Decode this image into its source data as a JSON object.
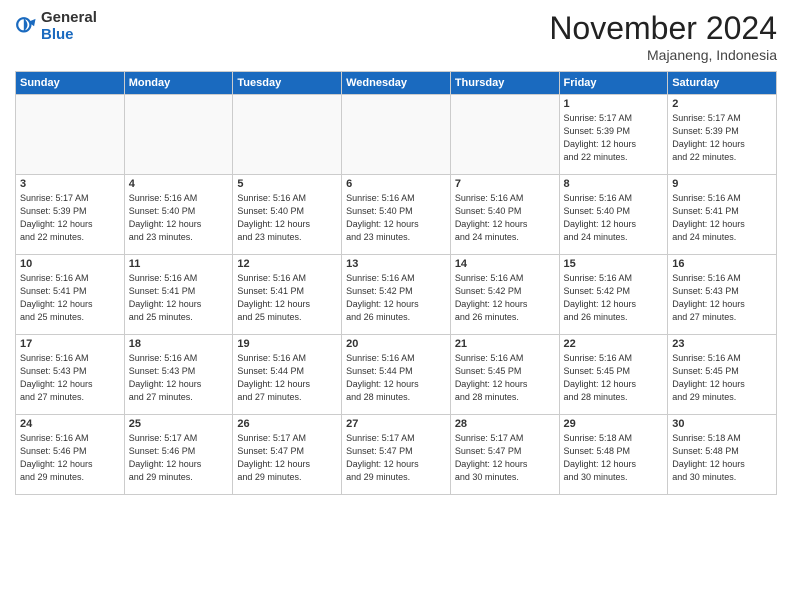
{
  "logo": {
    "general": "General",
    "blue": "Blue"
  },
  "header": {
    "month": "November 2024",
    "location": "Majaneng, Indonesia"
  },
  "weekdays": [
    "Sunday",
    "Monday",
    "Tuesday",
    "Wednesday",
    "Thursday",
    "Friday",
    "Saturday"
  ],
  "weeks": [
    [
      {
        "day": "",
        "info": ""
      },
      {
        "day": "",
        "info": ""
      },
      {
        "day": "",
        "info": ""
      },
      {
        "day": "",
        "info": ""
      },
      {
        "day": "",
        "info": ""
      },
      {
        "day": "1",
        "info": "Sunrise: 5:17 AM\nSunset: 5:39 PM\nDaylight: 12 hours\nand 22 minutes."
      },
      {
        "day": "2",
        "info": "Sunrise: 5:17 AM\nSunset: 5:39 PM\nDaylight: 12 hours\nand 22 minutes."
      }
    ],
    [
      {
        "day": "3",
        "info": "Sunrise: 5:17 AM\nSunset: 5:39 PM\nDaylight: 12 hours\nand 22 minutes."
      },
      {
        "day": "4",
        "info": "Sunrise: 5:16 AM\nSunset: 5:40 PM\nDaylight: 12 hours\nand 23 minutes."
      },
      {
        "day": "5",
        "info": "Sunrise: 5:16 AM\nSunset: 5:40 PM\nDaylight: 12 hours\nand 23 minutes."
      },
      {
        "day": "6",
        "info": "Sunrise: 5:16 AM\nSunset: 5:40 PM\nDaylight: 12 hours\nand 23 minutes."
      },
      {
        "day": "7",
        "info": "Sunrise: 5:16 AM\nSunset: 5:40 PM\nDaylight: 12 hours\nand 24 minutes."
      },
      {
        "day": "8",
        "info": "Sunrise: 5:16 AM\nSunset: 5:40 PM\nDaylight: 12 hours\nand 24 minutes."
      },
      {
        "day": "9",
        "info": "Sunrise: 5:16 AM\nSunset: 5:41 PM\nDaylight: 12 hours\nand 24 minutes."
      }
    ],
    [
      {
        "day": "10",
        "info": "Sunrise: 5:16 AM\nSunset: 5:41 PM\nDaylight: 12 hours\nand 25 minutes."
      },
      {
        "day": "11",
        "info": "Sunrise: 5:16 AM\nSunset: 5:41 PM\nDaylight: 12 hours\nand 25 minutes."
      },
      {
        "day": "12",
        "info": "Sunrise: 5:16 AM\nSunset: 5:41 PM\nDaylight: 12 hours\nand 25 minutes."
      },
      {
        "day": "13",
        "info": "Sunrise: 5:16 AM\nSunset: 5:42 PM\nDaylight: 12 hours\nand 26 minutes."
      },
      {
        "day": "14",
        "info": "Sunrise: 5:16 AM\nSunset: 5:42 PM\nDaylight: 12 hours\nand 26 minutes."
      },
      {
        "day": "15",
        "info": "Sunrise: 5:16 AM\nSunset: 5:42 PM\nDaylight: 12 hours\nand 26 minutes."
      },
      {
        "day": "16",
        "info": "Sunrise: 5:16 AM\nSunset: 5:43 PM\nDaylight: 12 hours\nand 27 minutes."
      }
    ],
    [
      {
        "day": "17",
        "info": "Sunrise: 5:16 AM\nSunset: 5:43 PM\nDaylight: 12 hours\nand 27 minutes."
      },
      {
        "day": "18",
        "info": "Sunrise: 5:16 AM\nSunset: 5:43 PM\nDaylight: 12 hours\nand 27 minutes."
      },
      {
        "day": "19",
        "info": "Sunrise: 5:16 AM\nSunset: 5:44 PM\nDaylight: 12 hours\nand 27 minutes."
      },
      {
        "day": "20",
        "info": "Sunrise: 5:16 AM\nSunset: 5:44 PM\nDaylight: 12 hours\nand 28 minutes."
      },
      {
        "day": "21",
        "info": "Sunrise: 5:16 AM\nSunset: 5:45 PM\nDaylight: 12 hours\nand 28 minutes."
      },
      {
        "day": "22",
        "info": "Sunrise: 5:16 AM\nSunset: 5:45 PM\nDaylight: 12 hours\nand 28 minutes."
      },
      {
        "day": "23",
        "info": "Sunrise: 5:16 AM\nSunset: 5:45 PM\nDaylight: 12 hours\nand 29 minutes."
      }
    ],
    [
      {
        "day": "24",
        "info": "Sunrise: 5:16 AM\nSunset: 5:46 PM\nDaylight: 12 hours\nand 29 minutes."
      },
      {
        "day": "25",
        "info": "Sunrise: 5:17 AM\nSunset: 5:46 PM\nDaylight: 12 hours\nand 29 minutes."
      },
      {
        "day": "26",
        "info": "Sunrise: 5:17 AM\nSunset: 5:47 PM\nDaylight: 12 hours\nand 29 minutes."
      },
      {
        "day": "27",
        "info": "Sunrise: 5:17 AM\nSunset: 5:47 PM\nDaylight: 12 hours\nand 29 minutes."
      },
      {
        "day": "28",
        "info": "Sunrise: 5:17 AM\nSunset: 5:47 PM\nDaylight: 12 hours\nand 30 minutes."
      },
      {
        "day": "29",
        "info": "Sunrise: 5:18 AM\nSunset: 5:48 PM\nDaylight: 12 hours\nand 30 minutes."
      },
      {
        "day": "30",
        "info": "Sunrise: 5:18 AM\nSunset: 5:48 PM\nDaylight: 12 hours\nand 30 minutes."
      }
    ]
  ]
}
